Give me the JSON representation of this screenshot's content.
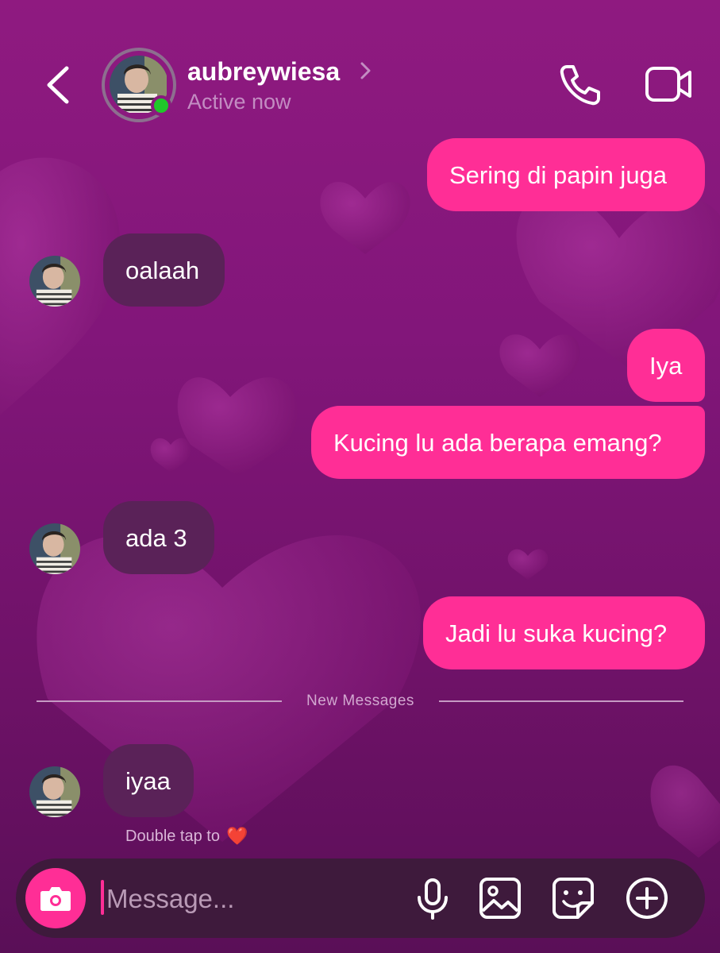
{
  "header": {
    "username": "aubreywiesa",
    "status": "Active now",
    "back_icon": "chevron-left-icon",
    "call_icon": "phone-icon",
    "video_icon": "video-camera-icon"
  },
  "messages": [
    {
      "from": "me",
      "text": "Sering di papin juga"
    },
    {
      "from": "them",
      "text": "oalaah"
    },
    {
      "from": "me",
      "text": "Iya"
    },
    {
      "from": "me",
      "text": "Kucing lu ada berapa emang?"
    },
    {
      "from": "them",
      "text": "ada 3"
    },
    {
      "from": "me",
      "text": "Jadi lu suka kucing?"
    },
    {
      "from": "them",
      "text": "iyaa"
    }
  ],
  "divider": {
    "label": "New Messages"
  },
  "hint": {
    "text": "Double tap to",
    "emoji": "❤️"
  },
  "composer": {
    "placeholder": "Message...",
    "tools": [
      "microphone-icon",
      "image-icon",
      "sticker-icon",
      "plus-circle-icon"
    ]
  },
  "colors": {
    "accent": "#ff2e96",
    "incoming_bubble": "#5a2258",
    "online": "#20c72a",
    "background": "#8a1a7e"
  }
}
